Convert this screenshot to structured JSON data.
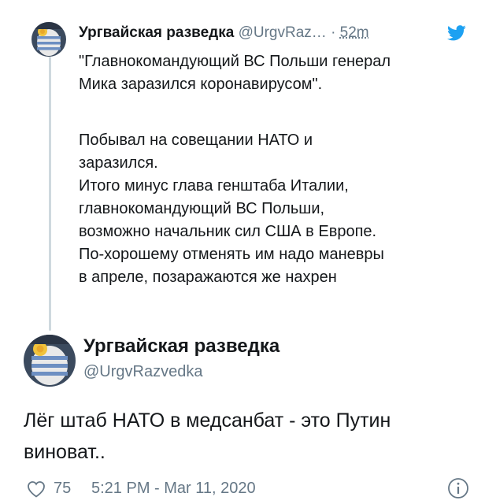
{
  "reply": {
    "display_name": "Ургвайская разведка",
    "handle": "@UrgvRaz…",
    "separator": "·",
    "time": "52m",
    "lines": [
      "\"Главнокомандующий ВС Польши генерал",
      "Мика заразился коронавирусом\"."
    ],
    "lines2": [
      "Побывал на совещании НАТО и",
      "заразился.",
      "Итого минус глава генштаба Италии,",
      "главнокомандующий ВС Польши,",
      "возможно начальник сил США в Европе.",
      "По-хорошему отменять им надо маневры",
      "в апреле, позаражаются же нахрен"
    ]
  },
  "main": {
    "display_name": "Ургвайская разведка",
    "handle": "@UrgvRazvedka",
    "text_line1": "Лёг штаб НАТО в медсанбат - это Путин",
    "text_line2": "виноват.."
  },
  "footer": {
    "likes": "75",
    "timestamp": "5:21 PM - Mar 11, 2020"
  },
  "colors": {
    "text": "#14171a",
    "secondary": "#657786",
    "twitter_blue": "#1da1f2",
    "thread_line": "#cfd9de"
  },
  "icons": {
    "bird": "twitter-bird-icon",
    "heart": "heart-outline-icon",
    "info": "info-circle-icon"
  }
}
